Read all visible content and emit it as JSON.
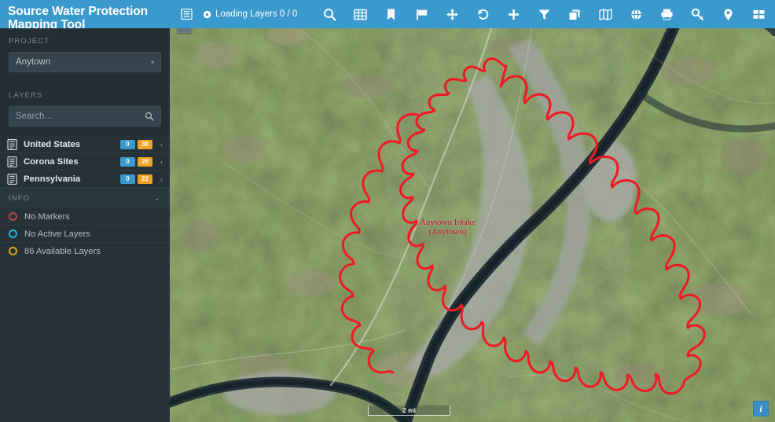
{
  "app": {
    "title_line1": "Source Water Protection",
    "title_line2": "Mapping Tool"
  },
  "sidebar": {
    "project_label": "PROJECT",
    "project_value": "Anytown",
    "layers_label": "LAYERS",
    "search_placeholder": "Search...",
    "layers": [
      {
        "name": "United States",
        "count_blue": "0",
        "count_orange": "38",
        "icon": "list-icon"
      },
      {
        "name": "Corona Sites",
        "count_blue": "0",
        "count_orange": "26",
        "icon": "list-icon"
      },
      {
        "name": "Pennsylvania",
        "count_blue": "0",
        "count_orange": "22",
        "icon": "list-icon"
      }
    ],
    "info_label": "INFO",
    "info_items": [
      {
        "text": "No Markers",
        "color": "#b34646"
      },
      {
        "text": "No Active Layers",
        "color": "#23b3d4"
      },
      {
        "text": "86 Available Layers",
        "color": "#e0a31d"
      }
    ]
  },
  "topbar": {
    "menu_icon": "hamburger-icon",
    "status_icon": "spinner-icon",
    "status_text": "Loading Layers 0 / 0",
    "tools": [
      "search-icon",
      "table-icon",
      "bookmark-icon",
      "flag-icon",
      "move-icon",
      "undo-icon",
      "plus-icon",
      "filter-icon",
      "layers-icon",
      "map-icon",
      "globe-icon",
      "print-icon",
      "key-icon",
      "pin-icon",
      "apps-grid-icon"
    ]
  },
  "map": {
    "zoom_in": "+",
    "zoom_out": "−",
    "scale_text": "2 mi",
    "info_button": "i",
    "feature_label_line1": "Anytown Intake",
    "feature_label_line2": "(Anytown)",
    "boundary_color": "#ed1c24",
    "basemap": "satellite-imagery"
  }
}
